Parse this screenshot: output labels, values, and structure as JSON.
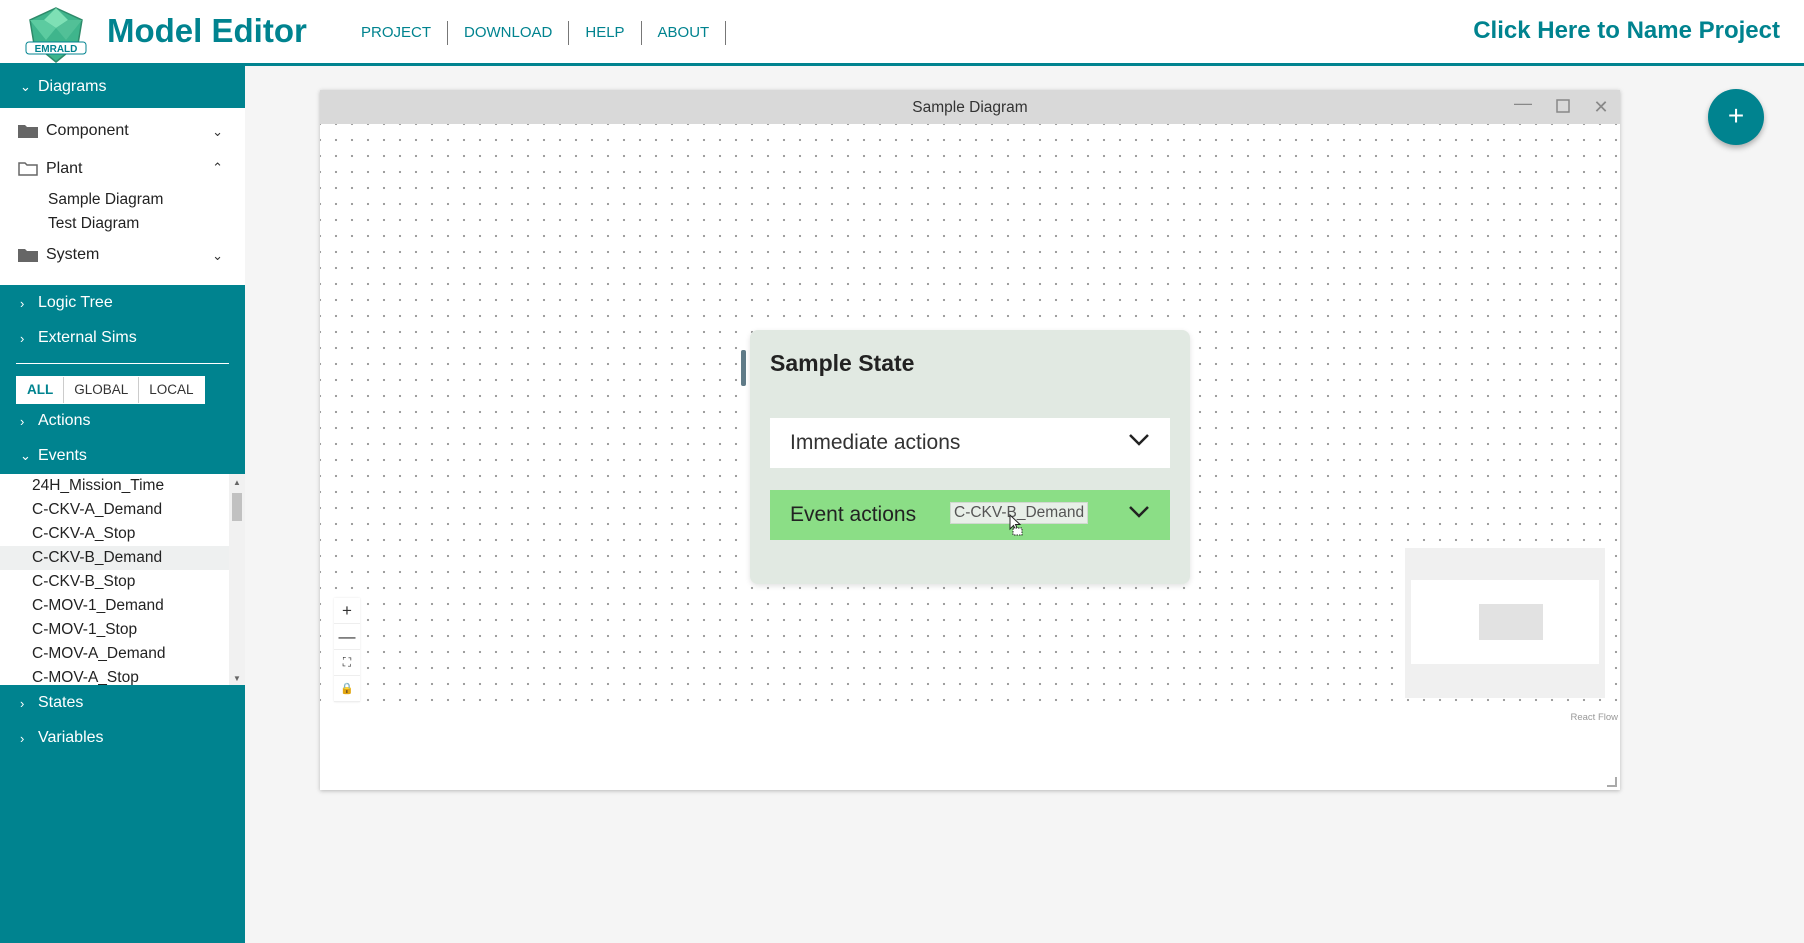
{
  "header": {
    "app_title": "Model Editor",
    "logo_text": "EMRALD",
    "menu": [
      "PROJECT",
      "DOWNLOAD",
      "HELP",
      "ABOUT"
    ],
    "project_name": "Click Here to Name Project"
  },
  "sidebar": {
    "diagrams_label": "Diagrams",
    "folders": [
      {
        "label": "Component",
        "icon": "folder-icon",
        "expanded": false
      },
      {
        "label": "Plant",
        "icon": "folder-open-icon",
        "expanded": true,
        "items": [
          "Sample Diagram",
          "Test Diagram"
        ]
      },
      {
        "label": "System",
        "icon": "folder-icon",
        "expanded": false
      }
    ],
    "logic_tree_label": "Logic Tree",
    "external_sims_label": "External Sims",
    "filters": [
      "ALL",
      "GLOBAL",
      "LOCAL"
    ],
    "actions_label": "Actions",
    "events_label": "Events",
    "events": [
      "24H_Mission_Time",
      "C-CKV-A_Demand",
      "C-CKV-A_Stop",
      "C-CKV-B_Demand",
      "C-CKV-B_Stop",
      "C-MOV-1_Demand",
      "C-MOV-1_Stop",
      "C-MOV-A_Demand",
      "C-MOV-A_Stop"
    ],
    "states_label": "States",
    "variables_label": "Variables"
  },
  "window": {
    "title": "Sample Diagram",
    "state": {
      "title": "Sample State",
      "immediate_actions": "Immediate actions",
      "event_actions": "Event actions",
      "dragging_item": "C-CKV-B_Demand"
    },
    "controls": [
      "+",
      "—",
      "⛶",
      "🔒"
    ],
    "attribution": "React Flow"
  },
  "fab_label": "+",
  "colors": {
    "brand": "#00838f",
    "event_actions_bg": "#8bde86",
    "node_bg": "#e1e9e2"
  }
}
